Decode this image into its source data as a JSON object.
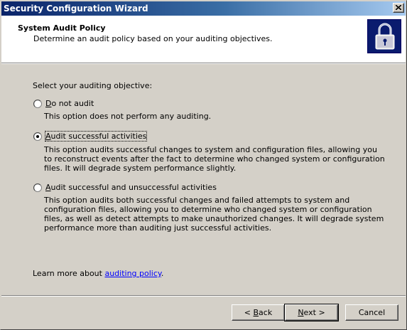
{
  "window": {
    "title": "Security Configuration Wizard"
  },
  "header": {
    "title": "System Audit Policy",
    "subtitle": "Determine an audit policy based on your auditing objectives.",
    "icon": "padlock-icon"
  },
  "content": {
    "prompt": "Select your auditing objective:",
    "options": [
      {
        "label_mnemonic": "D",
        "label_rest": "o not audit",
        "selected": false,
        "description": "This option does not perform any auditing."
      },
      {
        "label_mnemonic": "A",
        "label_rest": "udit successful activities",
        "selected": true,
        "description": "This option audits successful changes to system and configuration files, allowing you to reconstruct events after the fact to determine who changed system or configuration files. It will degrade system performance slightly."
      },
      {
        "label_mnemonic": "A",
        "label_rest": "udit successful and unsuccessful activities",
        "selected": false,
        "description": "This option audits both successful changes and failed attempts to system and configuration files, allowing you to determine who changed system or configuration files, as well as detect attempts to make unauthorized changes. It will degrade system performance more than auditing just successful activities."
      }
    ],
    "learn_more_prefix": "Learn more about ",
    "learn_more_link": "auditing policy",
    "learn_more_suffix": "."
  },
  "buttons": {
    "back_prefix": "< ",
    "back_mnemonic": "B",
    "back_rest": "ack",
    "next_mnemonic": "N",
    "next_rest": "ext >",
    "cancel": "Cancel"
  },
  "colors": {
    "title_gradient_start": "#0a246a",
    "title_gradient_end": "#a6caf0",
    "window_bg": "#d4d0c8",
    "link": "#0000ff"
  }
}
